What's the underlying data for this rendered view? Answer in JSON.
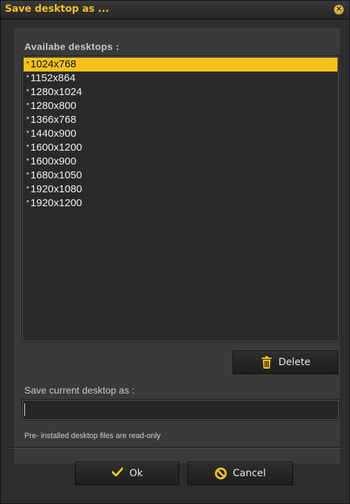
{
  "window": {
    "title": "Save desktop as ...",
    "close_glyph": "✕"
  },
  "list": {
    "label": "Availabe desktops :",
    "items": [
      {
        "label": "1024x768",
        "selected": true
      },
      {
        "label": "1152x864"
      },
      {
        "label": "1280x1024"
      },
      {
        "label": "1280x800"
      },
      {
        "label": "1366x768"
      },
      {
        "label": "1440x900"
      },
      {
        "label": "1600x1200"
      },
      {
        "label": "1600x900"
      },
      {
        "label": "1680x1050"
      },
      {
        "label": "1920x1080"
      },
      {
        "label": "1920x1200"
      }
    ],
    "bullet": "*"
  },
  "buttons": {
    "delete": "Delete",
    "ok": "Ok",
    "cancel": "Cancel"
  },
  "save": {
    "label": "Save current desktop as :",
    "value": ""
  },
  "note": "Pre- installed desktop files are read-only",
  "colors": {
    "accent": "#f4c21b",
    "background": "#2d2d2d"
  },
  "icons": {
    "delete": "trash-icon",
    "ok": "checkmark-icon",
    "cancel": "cancel-icon",
    "close": "close-icon"
  }
}
